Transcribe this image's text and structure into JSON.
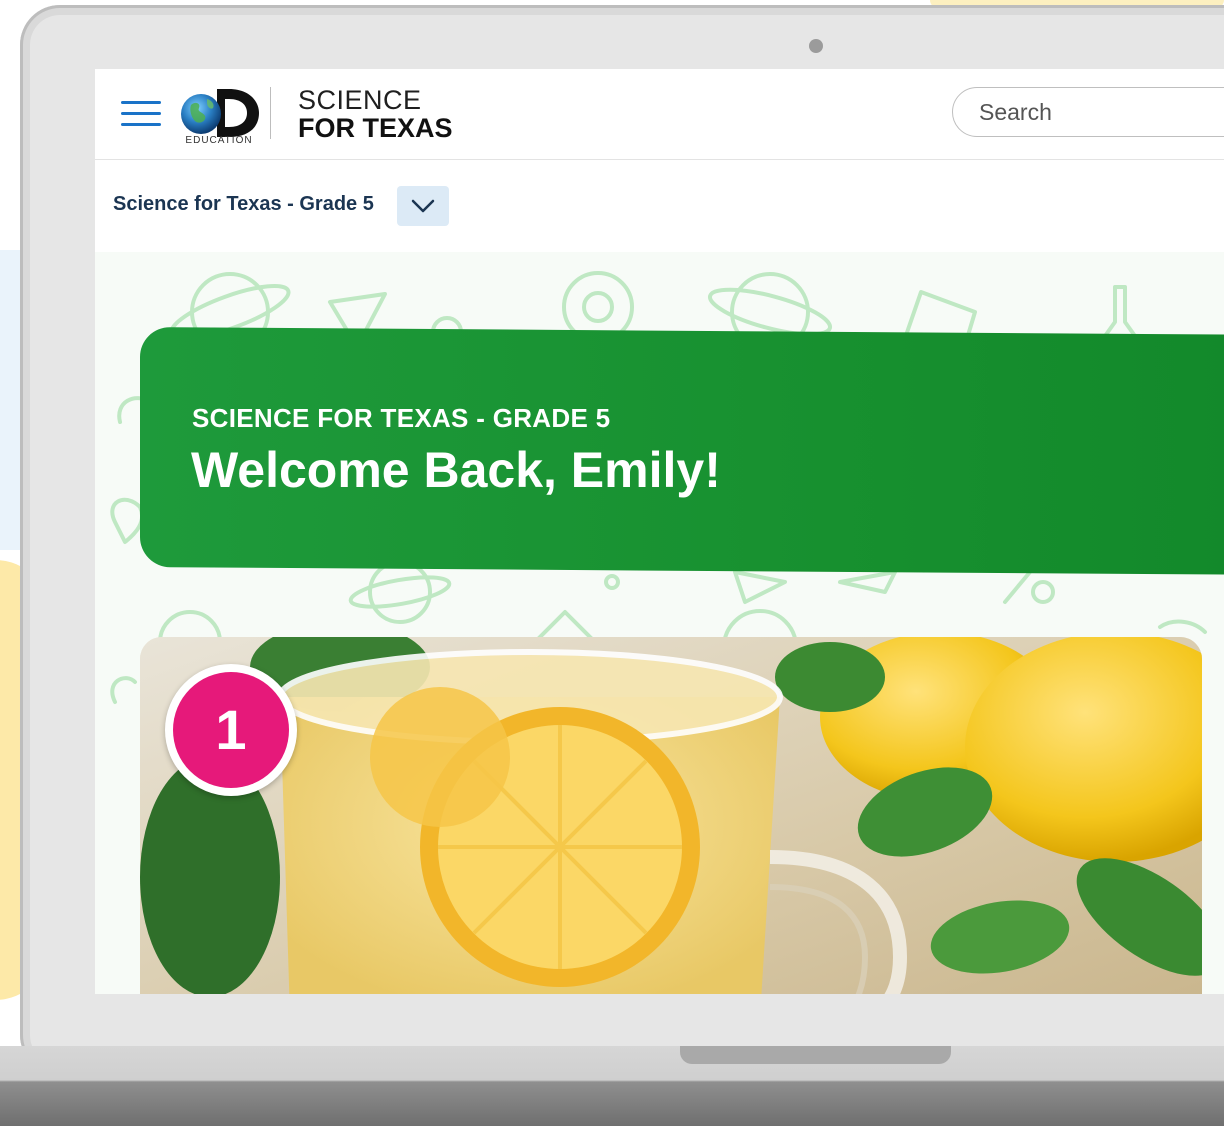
{
  "brand": {
    "logo_caption": "EDUCATION",
    "line1": "SCIENCE",
    "line2": "FOR TEXAS"
  },
  "search": {
    "placeholder": "Search"
  },
  "course_selector": {
    "label": "Science for Texas - Grade 5"
  },
  "banner": {
    "subtitle": "SCIENCE FOR TEXAS - GRADE 5",
    "title": "Welcome Back, Emily!"
  },
  "lesson_card": {
    "number": "1"
  },
  "colors": {
    "accent_blue": "#1a73c8",
    "banner_green": "#1a9336",
    "badge_pink": "#e6197a",
    "course_text": "#1b3552"
  },
  "icons": [
    "hamburger-icon",
    "discovery-logo",
    "chevron-down-icon"
  ]
}
